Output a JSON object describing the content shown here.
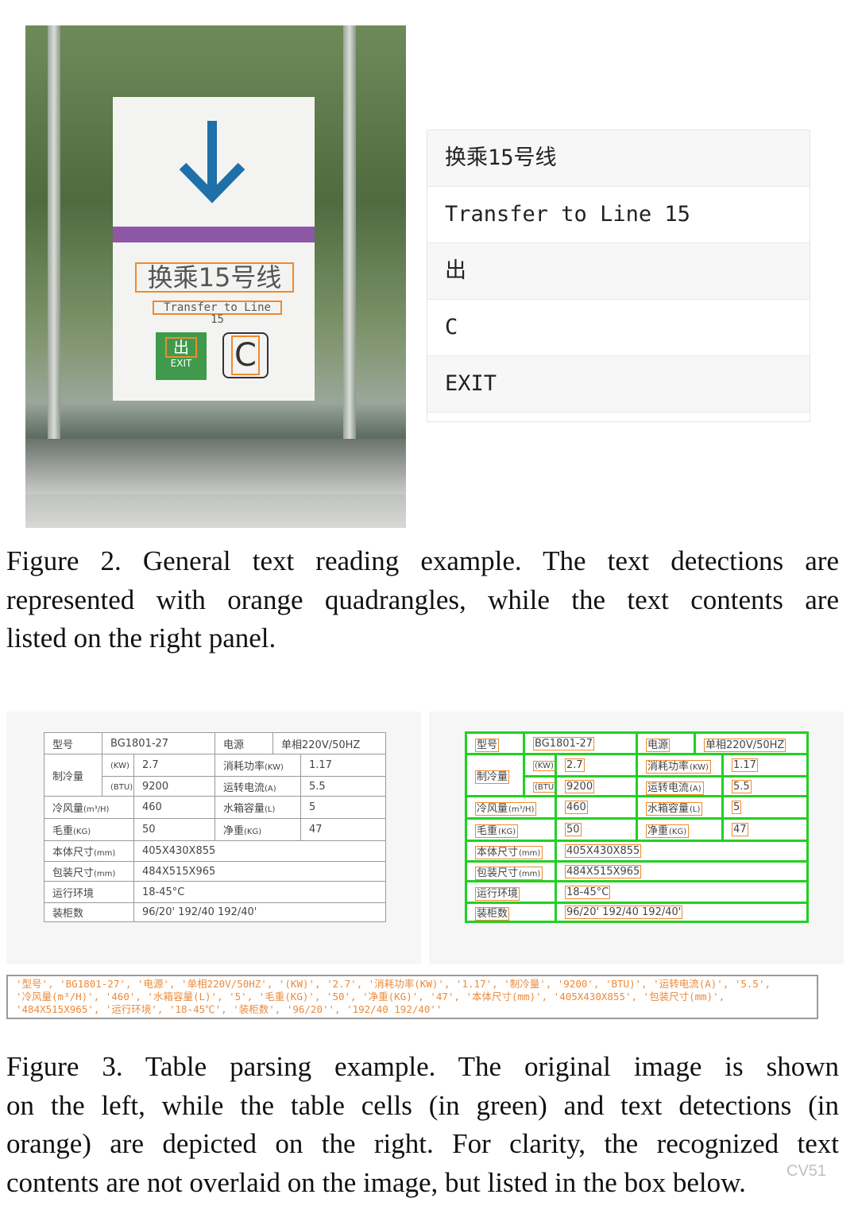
{
  "figure2": {
    "sign": {
      "chinese": "换乘15号线",
      "english": "Transfer to Line 15",
      "exit_label": "EXIT",
      "c_label": "C"
    },
    "panel_items": [
      "换乘15号线",
      "Transfer to Line 15",
      "出",
      "C",
      "EXIT"
    ],
    "caption": [
      "Figure 2.  General text reading example.  The text detections are",
      "represented with orange quadrangles, while the text contents are",
      "listed on the right panel."
    ]
  },
  "figure3": {
    "table_rows": [
      [
        {
          "t": "型号"
        },
        {
          "t": "BG1801-27",
          "cs": 2
        },
        {
          "t": "电源"
        },
        {
          "t": "单相220V/50HZ",
          "cs": 2
        }
      ],
      [
        {
          "t": "制冷量",
          "rs": 2
        },
        {
          "t": "(KW)",
          "small": true
        },
        {
          "t": "2.7"
        },
        {
          "t": "消耗功率",
          "u": "(KW)",
          "cs": 2
        },
        {
          "t": "1.17"
        }
      ],
      [
        {
          "t": "(BTU)",
          "small": true
        },
        {
          "t": "9200"
        },
        {
          "t": "运转电流",
          "u": "(A)",
          "cs": 2
        },
        {
          "t": "5.5"
        }
      ],
      [
        {
          "t": "冷风量",
          "u": "(m³/H)",
          "cs": 2
        },
        {
          "t": "460"
        },
        {
          "t": "水箱容量",
          "u": "(L)",
          "cs": 2
        },
        {
          "t": "5"
        }
      ],
      [
        {
          "t": "毛重",
          "u": "(KG)",
          "cs": 2
        },
        {
          "t": "50"
        },
        {
          "t": "净重",
          "u": "(KG)",
          "cs": 2
        },
        {
          "t": "47"
        }
      ],
      [
        {
          "t": "本体尺寸",
          "u": "(mm)",
          "cs": 2
        },
        {
          "t": "405X430X855",
          "cs": 4
        }
      ],
      [
        {
          "t": "包装尺寸",
          "u": "(mm)",
          "cs": 2
        },
        {
          "t": "484X515X965",
          "cs": 4
        }
      ],
      [
        {
          "t": "运行环境",
          "cs": 2
        },
        {
          "t": "18-45°C",
          "cs": 4
        }
      ],
      [
        {
          "t": "装柜数",
          "cs": 2
        },
        {
          "t": "96/20'   192/40 192/40'",
          "cs": 4
        }
      ]
    ],
    "recognized_text": "'型号', 'BG1801-27', '电源', '单相220V/50HZ', '(KW)', '2.7', '消耗功率(KW)', '1.17', '制冷量', '9200', 'BTU)', '运转电流(A)', '5.5',\n'冷风量(m³/H)', '460', '水箱容量(L)', '5', '毛重(KG)', '50', '净重(KG)', '47', '本体尺寸(mm)', '405X430X855', '包装尺寸(mm)',\n'484X515X965', '运行环境', '18-45℃', '装柜数', '96/20'', '192/40 192/40''",
    "caption": [
      "Figure 3.  Table parsing example.  The original image is shown",
      "on the left, while the table cells (in green) and text detections (in",
      "orange) are depicted on the right.  For clarity, the recognized text",
      "contents are not overlaid on the image, but listed in the box below."
    ],
    "colors": {
      "cell_border": "#22d022",
      "detection": "#f08a2c"
    }
  },
  "watermark": "CV51"
}
